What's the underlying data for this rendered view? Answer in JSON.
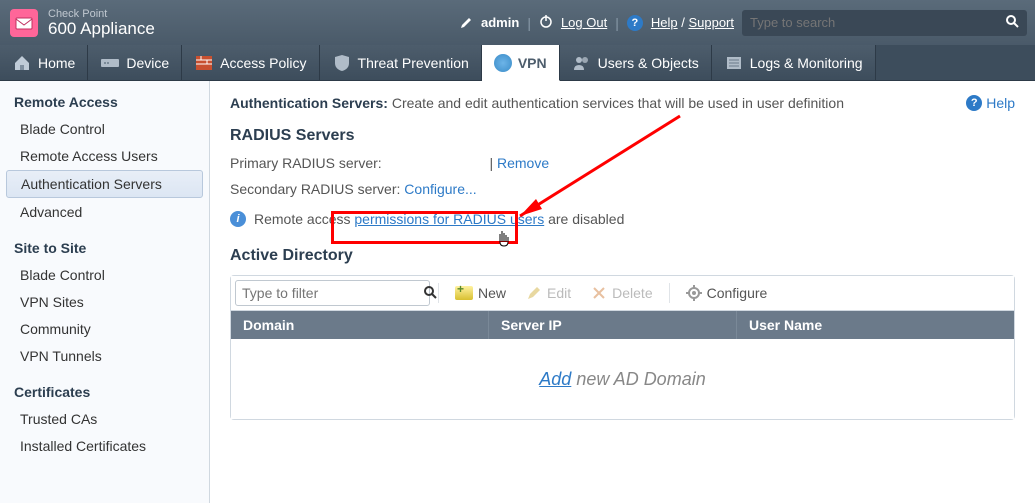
{
  "header": {
    "brand_small": "Check Point",
    "brand_large": "600 Appliance",
    "user_label": "admin",
    "logout_label": "Log Out",
    "help_label": "Help",
    "support_label": "Support",
    "search_placeholder": "Type to search"
  },
  "nav": {
    "tabs": [
      {
        "label": "Home"
      },
      {
        "label": "Device"
      },
      {
        "label": "Access Policy"
      },
      {
        "label": "Threat Prevention"
      },
      {
        "label": "VPN"
      },
      {
        "label": "Users & Objects"
      },
      {
        "label": "Logs & Monitoring"
      }
    ]
  },
  "sidebar": {
    "groups": [
      {
        "heading": "Remote Access",
        "items": [
          "Blade Control",
          "Remote Access Users",
          "Authentication Servers",
          "Advanced"
        ]
      },
      {
        "heading": "Site to Site",
        "items": [
          "Blade Control",
          "VPN Sites",
          "Community",
          "VPN Tunnels"
        ]
      },
      {
        "heading": "Certificates",
        "items": [
          "Trusted CAs",
          "Installed Certificates"
        ]
      }
    ],
    "active": "Authentication Servers"
  },
  "page": {
    "title_bold": "Authentication Servers:",
    "title_desc": "Create and edit authentication services that will be used in user definition",
    "help_link": "Help"
  },
  "radius": {
    "section_title": "RADIUS Servers",
    "primary_label": "Primary RADIUS server:",
    "primary_sep": "|",
    "primary_remove": "Remove",
    "secondary_label": "Secondary RADIUS server:",
    "secondary_configure": "Configure...",
    "info_prefix": "Remote access",
    "info_link": "permissions for RADIUS users",
    "info_suffix": "are disabled"
  },
  "active_directory": {
    "section_title": "Active Directory",
    "filter_placeholder": "Type to filter",
    "toolbar": {
      "new": "New",
      "edit": "Edit",
      "delete": "Delete",
      "configure": "Configure"
    },
    "columns": {
      "domain": "Domain",
      "server_ip": "Server IP",
      "user_name": "User Name"
    },
    "empty_add": "Add",
    "empty_text": "new AD Domain"
  }
}
